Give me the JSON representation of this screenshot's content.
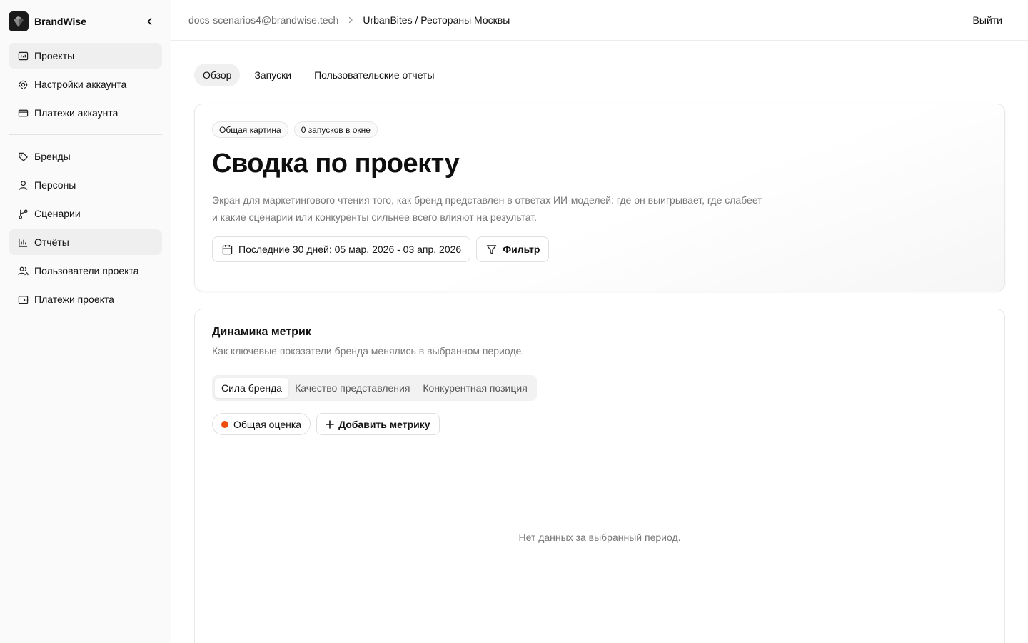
{
  "app": {
    "name": "BrandWise"
  },
  "sidebar": {
    "top_items": [
      {
        "label": "Проекты",
        "icon": "projects-icon"
      },
      {
        "label": "Настройки аккаунта",
        "icon": "gear-icon"
      },
      {
        "label": "Платежи аккаунта",
        "icon": "credit-card-icon"
      }
    ],
    "project_items": [
      {
        "label": "Бренды",
        "icon": "tag-icon"
      },
      {
        "label": "Персоны",
        "icon": "user-icon"
      },
      {
        "label": "Сценарии",
        "icon": "branch-icon"
      },
      {
        "label": "Отчёты",
        "icon": "bar-chart-icon"
      },
      {
        "label": "Пользователи проекта",
        "icon": "users-icon"
      },
      {
        "label": "Платежи проекта",
        "icon": "wallet-icon"
      }
    ]
  },
  "header": {
    "account_email": "docs-scenarios4@brandwise.tech",
    "project": "UrbanBites / Рестораны Москвы",
    "logout_label": "Выйти"
  },
  "tabs": [
    "Обзор",
    "Запуски",
    "Пользовательские отчеты"
  ],
  "hero": {
    "badges": [
      "Общая картина",
      "0 запусков в окне"
    ],
    "title": "Сводка по проекту",
    "description": "Экран для маркетингового чтения того, как бренд представлен в ответах ИИ-моделей: где он выигрывает, где слабеет и какие сценарии или конкуренты сильнее всего влияют на результат.",
    "date_range_label": "Последние 30 дней: 05 мар. 2026 - 03 апр. 2026",
    "filter_label": "Фильтр"
  },
  "metrics": {
    "title": "Динамика метрик",
    "subtitle": "Как ключевые показатели бренда менялись в выбранном периоде.",
    "segments": [
      "Сила бренда",
      "Качество представления",
      "Конкурентная позиция"
    ],
    "chip_label": "Общая оценка",
    "chip_color": "#f04e0c",
    "add_metric_label": "Добавить метрику",
    "empty_text": "Нет данных за выбранный период."
  }
}
